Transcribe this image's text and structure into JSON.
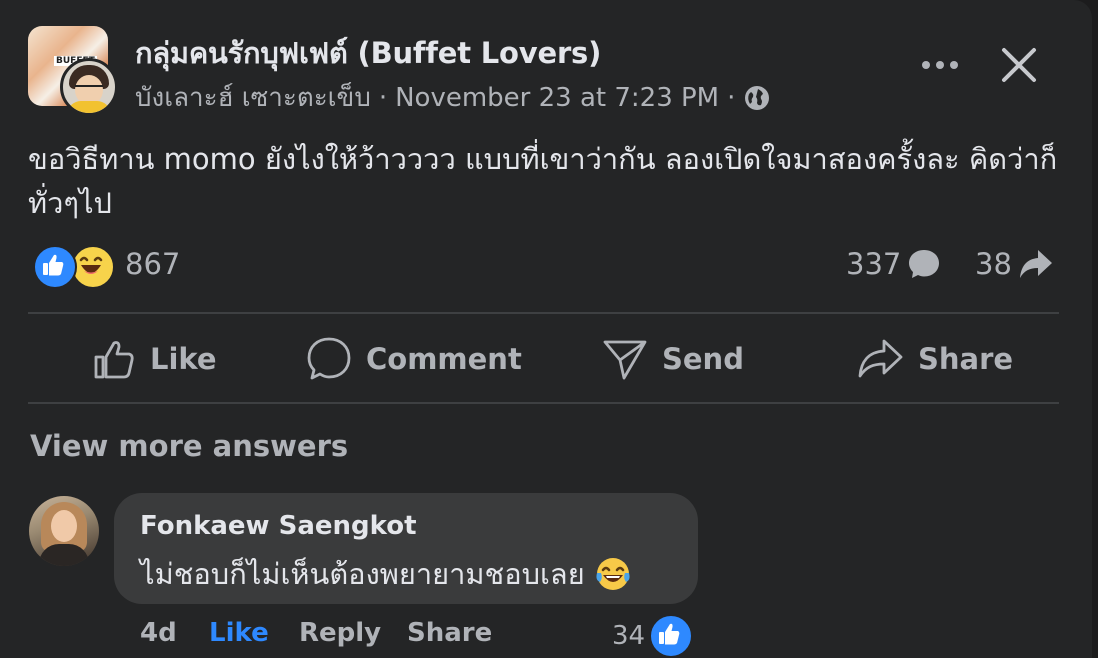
{
  "post": {
    "group_name": "กลุ่มคนรักบุฟเฟต์ (Buffet Lovers)",
    "group_thumb_tag": "BUFFET",
    "author": "บังเลาะฮ์ เซาะตะเข็บ",
    "separator": "·",
    "timestamp": "November 23 at 7:23 PM",
    "privacy_icon": "globe-icon",
    "body": "ขอวิธีทาน momo ยังไงให้ว้าวววว แบบที่เขาว่ากัน ลองเปิดใจมาสองครั้งละ คิดว่าก็ทั่วๆไป"
  },
  "stats": {
    "reactions": "867",
    "reaction_icons": [
      "like-icon",
      "haha-icon"
    ],
    "comments": "337",
    "shares": "38"
  },
  "actions": {
    "like": "Like",
    "comment": "Comment",
    "send": "Send",
    "share": "Share"
  },
  "comments_section": {
    "view_more": "View more answers",
    "comment": {
      "author": "Fonkaew Saengkot",
      "text": "ไม่ชอบก็ไม่เห็นต้องพยายามชอบเลย",
      "emoji": "tears-of-joy-icon",
      "time": "4d",
      "like": "Like",
      "reply": "Reply",
      "share": "Share",
      "like_count": "34"
    }
  },
  "colors": {
    "background": "#242526",
    "bubble": "#3a3b3c",
    "accent": "#2e89ff",
    "secondary_text": "#b0b3b8",
    "primary_text": "#e4e6eb"
  }
}
